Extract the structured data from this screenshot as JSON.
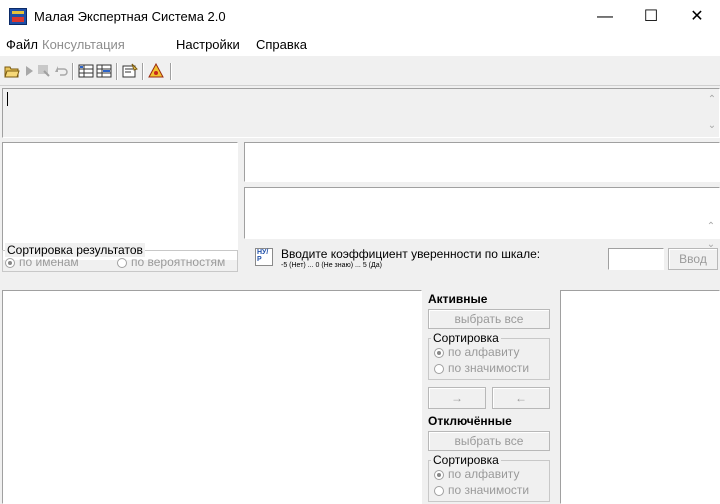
{
  "window": {
    "title": "Малая Экспертная Система 2.0",
    "minimize_glyph": "—",
    "maximize_glyph": "☐",
    "close_glyph": "✕"
  },
  "menu": {
    "items": [
      {
        "label": "Файл",
        "enabled": true
      },
      {
        "label": "Консультация",
        "enabled": false
      },
      {
        "label": "Настройки",
        "enabled": true
      },
      {
        "label": "Справка",
        "enabled": true
      }
    ]
  },
  "toolbar": {
    "icons": [
      "open-folder-icon",
      "play-icon",
      "run-disabled-icon",
      "undo-icon",
      "table-icon",
      "table-edit-icon",
      "settings-icon",
      "warning-icon"
    ]
  },
  "sort_results": {
    "caption": "Сортировка результатов",
    "by_name": "по именам",
    "by_probability": "по вероятностям",
    "selected": "by_name"
  },
  "input_hint": {
    "badge": "НУ/Р",
    "line1": "Вводите коэффициент уверенности по шкале:",
    "line2": "-5 (Нет) ... 0 (Не знаю) ... 5 (Да)",
    "value": "",
    "enter_button": "Ввод"
  },
  "active_panel": {
    "title": "Активные",
    "select_all": "выбрать все",
    "sort_caption": "Сортировка",
    "sort_alpha": "по алфавиту",
    "sort_significance": "по значимости",
    "selected": "alpha"
  },
  "move_buttons": {
    "right": "→",
    "left": "←"
  },
  "disabled_panel": {
    "title": "Отключённые",
    "select_all": "выбрать все",
    "sort_caption": "Сортировка",
    "sort_alpha": "по алфавиту",
    "sort_significance": "по значимости",
    "selected": "alpha"
  },
  "colors": {
    "background": "#f0f0f0",
    "field": "#ffffff",
    "disabled_text": "#9a9a9a",
    "app_icon": "#1f4fa8"
  }
}
